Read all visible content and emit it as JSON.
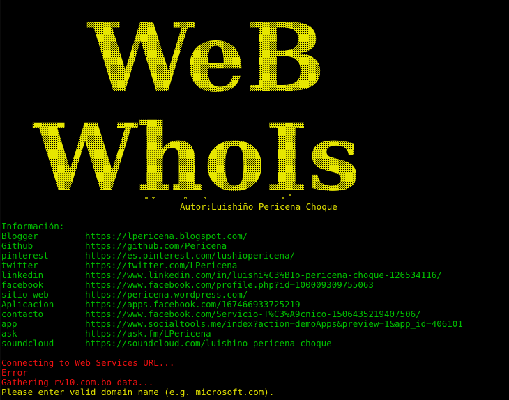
{
  "banner": {
    "line1": "WeB",
    "line2": "WhoIs",
    "color": "#e6e600"
  },
  "author": "Autor:Luishiño Pericena Choque",
  "info": {
    "title": "Información:",
    "items": [
      {
        "key": "Blogger",
        "value": "https://lpericena.blogspot.com/"
      },
      {
        "key": "Github",
        "value": "https://github.com/Pericena"
      },
      {
        "key": "pinterest",
        "value": "https://es.pinterest.com/lushiopericena/"
      },
      {
        "key": "twitter",
        "value": "https://twitter.com/LPericena"
      },
      {
        "key": "linkedin",
        "value": "https://www.linkedin.com/in/luishi%C3%B1o-pericena-choque-126534116/"
      },
      {
        "key": "facebook",
        "value": "https://www.facebook.com/profile.php?id=100009309755063"
      },
      {
        "key": "sitio web",
        "value": "https://pericena.wordpress.com/"
      },
      {
        "key": "Aplicacion",
        "value": "https://apps.facebook.com/167466933725219"
      },
      {
        "key": "contacto",
        "value": "https://www.facebook.com/Servicio-T%C3%A9cnico-1506435219407506/"
      },
      {
        "key": "app",
        "value": "https://www.socialtools.me/index?action=demoApps&preview=1&app_id=406101"
      },
      {
        "key": "ask",
        "value": "https://ask.fm/LPericena"
      },
      {
        "key": "soundcloud",
        "value": "https://soundcloud.com/luishino-pericena-choque"
      }
    ]
  },
  "status": {
    "lines": [
      "Connecting to Web Services URL...",
      "Error",
      "Gathering rv10.com.bo data..."
    ]
  },
  "prompt": "Please enter valid domain name (e.g. microsoft.com).",
  "colors": {
    "green": "#00c000",
    "yellow": "#e0e000",
    "red": "#ee1111",
    "background": "#000000"
  }
}
